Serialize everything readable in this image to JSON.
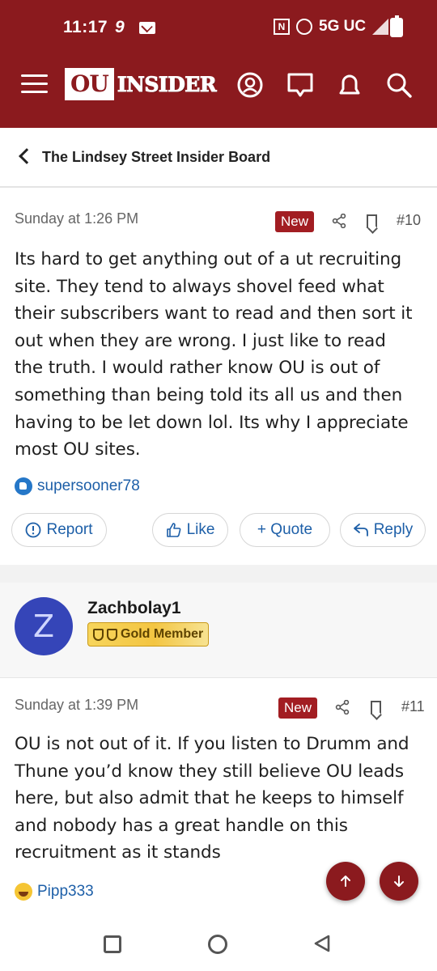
{
  "status_bar": {
    "time": "11:17",
    "notification_digit": "9",
    "nfc": "N",
    "network": "5G UC"
  },
  "header": {
    "logo_ou": "OU",
    "logo_insider": "INSIDER",
    "brand_color": "#8b1a1e",
    "icons": [
      "menu-icon",
      "account-icon",
      "messages-icon",
      "alerts-icon",
      "search-icon"
    ]
  },
  "breadcrumb": {
    "label": "The Lindsey Street Insider Board"
  },
  "posts": [
    {
      "timestamp": "Sunday at 1:26 PM",
      "badge": "New",
      "number": "#10",
      "lines": [
        "Its hard to get anything out of a ut recruiting",
        "site. They tend to always shovel feed what",
        "their subscribers want to read and then sort it",
        "out when they are wrong. I just like to read",
        "the truth. I would rather know OU is out of",
        "something than being told its all us and then",
        "having to be let down lol. Its why I appreciate",
        "most OU sites."
      ],
      "reaction_user": "supersooner78",
      "actions": {
        "report": "Report",
        "like": "Like",
        "quote": "+ Quote",
        "reply": "Reply"
      }
    },
    {
      "author": "Zachbolay1",
      "avatar_letter": "Z",
      "rank": "Gold Member",
      "timestamp": "Sunday at 1:39 PM",
      "badge": "New",
      "number": "#11",
      "lines": [
        "OU is not out of it. If you listen to Drumm and",
        "Thune you’d know they still believe OU leads",
        "here, but also admit that he keeps to himself",
        "and nobody has a great handle on this",
        "recruitment as it stands"
      ],
      "reaction_user": "Pipp333"
    }
  ]
}
